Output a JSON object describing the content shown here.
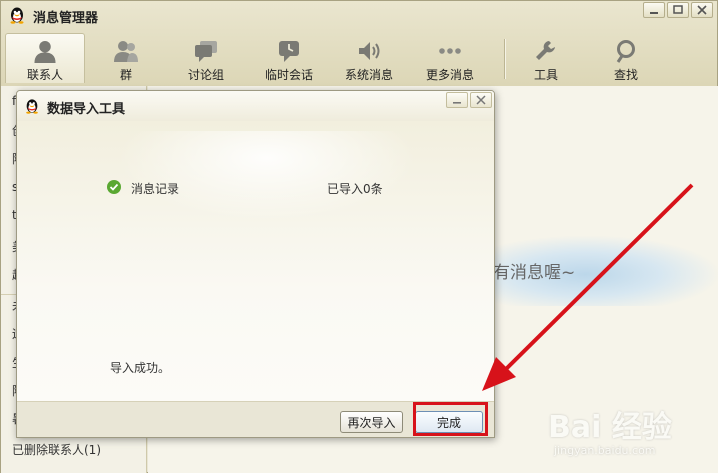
{
  "window": {
    "title": "消息管理器"
  },
  "toolbar": {
    "items": [
      {
        "label": "联系人",
        "icon": "person-icon",
        "active": true
      },
      {
        "label": "群",
        "icon": "group-icon"
      },
      {
        "label": "讨论组",
        "icon": "discussion-icon"
      },
      {
        "label": "临时会话",
        "icon": "temp-chat-icon"
      },
      {
        "label": "系统消息",
        "icon": "speaker-icon"
      },
      {
        "label": "更多消息",
        "icon": "more-dots-icon"
      },
      {
        "label": "工具",
        "icon": "wrench-icon"
      },
      {
        "label": "查找",
        "icon": "search-icon"
      }
    ]
  },
  "left_panel": {
    "visible_chars": [
      "f",
      "创",
      "阿",
      "s",
      "t",
      "美",
      "超",
      "未",
      "运",
      "生",
      "阿",
      "暑"
    ],
    "bottom_item": "已删除联系人(1)"
  },
  "content": {
    "empty_message_partial": "有消息喔~"
  },
  "dialog": {
    "title": "数据导入工具",
    "record_label": "消息记录",
    "record_status": "已导入0条",
    "success_text": "导入成功。",
    "reimport_button": "再次导入",
    "done_button": "完成"
  },
  "watermark": {
    "logo": "Bai 经验",
    "url": "jingyan.baidu.com"
  },
  "colors": {
    "annotation": "#d7121a",
    "check": "#5aa832"
  }
}
